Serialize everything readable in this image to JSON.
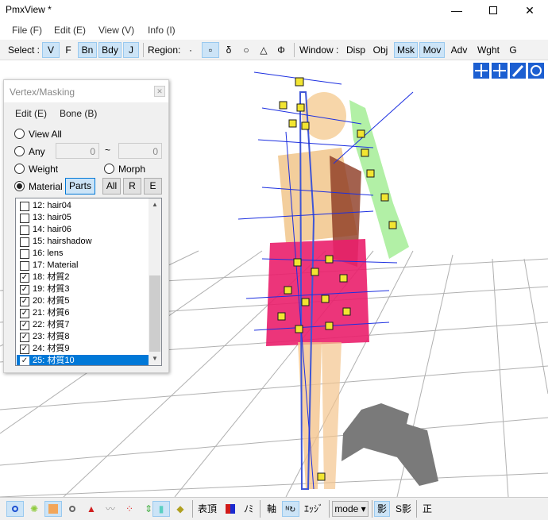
{
  "window": {
    "title": "PmxView *"
  },
  "menu": [
    "File (F)",
    "Edit (E)",
    "View (V)",
    "Info (I)"
  ],
  "toolbar": {
    "select_label": "Select :",
    "select_buttons": [
      "V",
      "F",
      "Bn",
      "Bdy",
      "J"
    ],
    "region_label": "Region:",
    "region_buttons": [
      "·",
      "▫",
      "δ",
      "○",
      "△",
      "Φ"
    ],
    "window_label": "Window :",
    "window_buttons": [
      "Disp",
      "Obj",
      "Msk",
      "Mov",
      "Adv",
      "Wght",
      "G"
    ]
  },
  "panel": {
    "title": "Vertex/Masking",
    "menu": [
      "Edit (E)",
      "Bone (B)"
    ],
    "view_all": "View All",
    "any": "Any",
    "any_from": "0",
    "tilde": "~",
    "any_to": "0",
    "weight": "Weight",
    "morph": "Morph",
    "material": "Material",
    "buttons": [
      "Parts",
      "All",
      "R",
      "E"
    ],
    "list": [
      {
        "label": "12: hair04",
        "checked": false
      },
      {
        "label": "13: hair05",
        "checked": false
      },
      {
        "label": "14: hair06",
        "checked": false
      },
      {
        "label": "15: hairshadow",
        "checked": false
      },
      {
        "label": "16: lens",
        "checked": false
      },
      {
        "label": "17: Material",
        "checked": false
      },
      {
        "label": "18: 材質2",
        "checked": true
      },
      {
        "label": "19: 材質3",
        "checked": true
      },
      {
        "label": "20: 材質5",
        "checked": true
      },
      {
        "label": "21: 材質6",
        "checked": true
      },
      {
        "label": "22: 材質7",
        "checked": true
      },
      {
        "label": "23: 材質8",
        "checked": true
      },
      {
        "label": "24: 材質9",
        "checked": true
      },
      {
        "label": "25: 材質10",
        "checked": true
      }
    ],
    "selected_item": "25: 材質10"
  },
  "statusbar": {
    "labels": [
      "表頂",
      "ﾉﾐ",
      "軸",
      "ｴｯｼﾞ",
      "mode ▾",
      "影",
      "S影",
      "正"
    ]
  },
  "colors": {
    "accent": "#0078d7",
    "toggle_on": "#cce4f7"
  }
}
